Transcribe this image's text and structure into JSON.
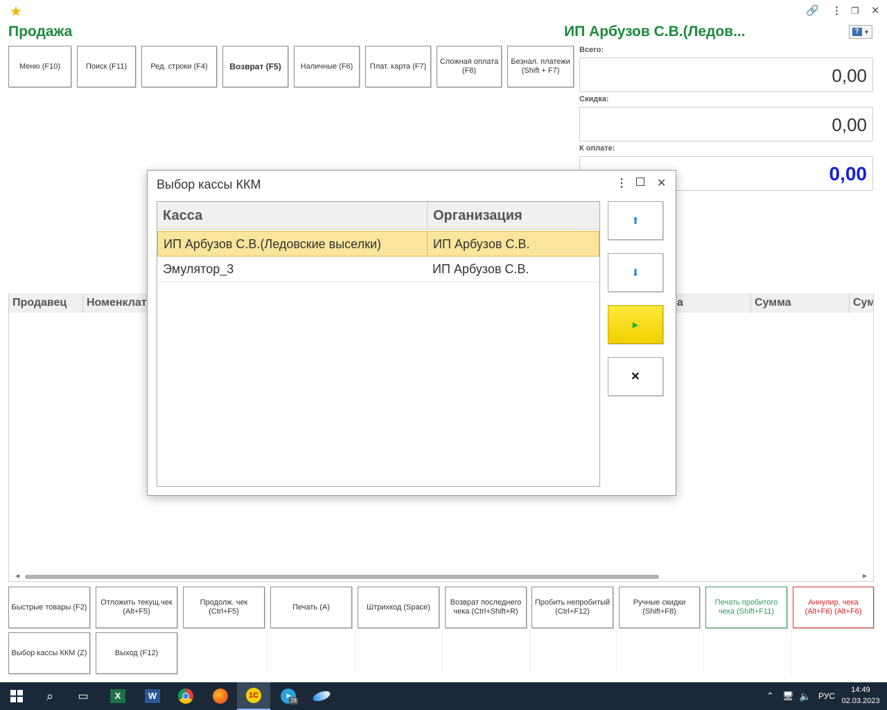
{
  "colors": {
    "accent_green": "#1d8a3a",
    "sum_blue": "#1421d6",
    "selected_row": "#fae59c",
    "ok_button": "#f1cf00"
  },
  "header": {
    "title": "Продажа",
    "org_name": "ИП Арбузов С.В.(Ледов..."
  },
  "top_icons": [
    "star-icon",
    "link-icon",
    "more-icon",
    "restore-icon",
    "close-icon",
    "help-icon"
  ],
  "toolbar": {
    "menu": "Меню (F10)",
    "search": "Поиск (F11)",
    "edit_row": "Ред. строки (F4)",
    "return": "Возврат (F5)",
    "cash": "Наличные (F6)",
    "card": "Плат. карта (F7)",
    "complex_pay": "Сложная оплата (F8)",
    "cashless": "Безнал. платежи (Shift + F7)"
  },
  "summary": {
    "total_label": "Всего:",
    "total_value": "0,00",
    "discount_label": "Скидка:",
    "discount_value": "0,00",
    "topay_label": "К оплате:",
    "topay_value": "0,00"
  },
  "grid": {
    "columns": [
      "Продавец",
      "Номенклатура",
      "а",
      "Сумма",
      "Сум"
    ]
  },
  "dialog": {
    "title": "Выбор кассы ККМ",
    "columns": [
      "Касса",
      "Организация"
    ],
    "rows": [
      {
        "kassa": "ИП Арбузов С.В.(Ледовские выселки)",
        "org": "ИП Арбузов С.В."
      },
      {
        "kassa": "Эмулятор_3",
        "org": "ИП Арбузов С.В."
      }
    ],
    "buttons": [
      "up-arrow-icon",
      "down-arrow-icon",
      "play-icon",
      "close-icon"
    ]
  },
  "bottom": {
    "quick_goods": "Быстрые товары (F2)",
    "defer_check": "Отложить текущ.чек (Alt+F5)",
    "continue_check": "Продолж. чек (Ctrl+F5)",
    "print": "Печать (A)",
    "barcode": "Штрихкод (Space)",
    "return_last": "Возврат последнего чека (Ctrl+Shift+R)",
    "punch_unpunched": "Пробить непробитый (Ctrl+F12)",
    "manual_discounts": "Ручные скидки (Shift+F8)",
    "print_punched": "Печать пробитого чека (Shift+F11)",
    "cancel_check": "Аннулир. чека (Alt+F6) (Alt+F6)",
    "select_kkm": "Выбор кассы ККМ (Z)",
    "exit": "Выход (F12)"
  },
  "taskbar": {
    "apps": [
      "windows-start-icon",
      "search-icon",
      "task-view-icon",
      "excel-icon",
      "word-icon",
      "chrome-icon",
      "firefox-icon",
      "1c-icon",
      "telegram-icon",
      "app-icon"
    ],
    "telegram_badge": "28",
    "lang": "РУС",
    "time": "14:49",
    "date": "02.03.2023"
  }
}
